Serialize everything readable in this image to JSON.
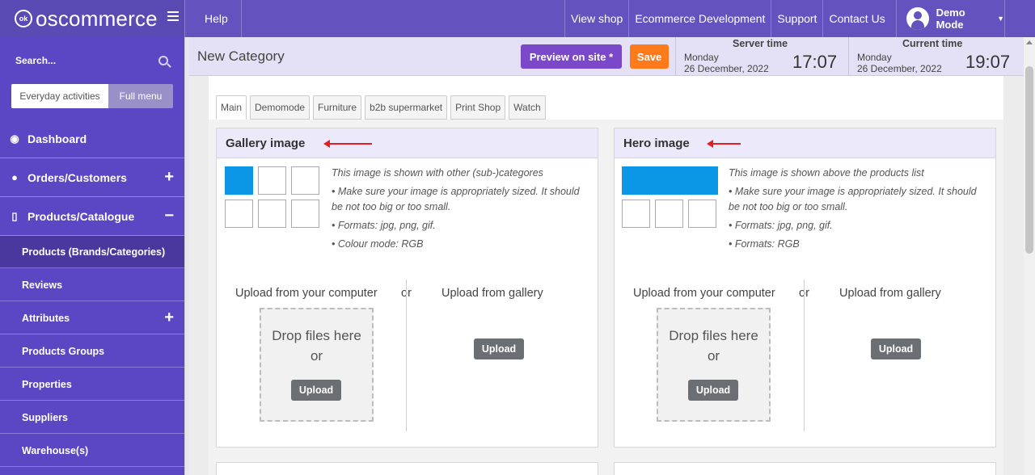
{
  "brand": {
    "logo_mark": "ok",
    "name": "oscommerce"
  },
  "sidebar": {
    "search_placeholder": "Search...",
    "modes": {
      "everyday": "Everyday activities",
      "full": "Full menu"
    },
    "main_items": [
      {
        "label": "Dashboard",
        "icon": "dashboard-icon"
      },
      {
        "label": "Orders/Customers",
        "icon": "users-icon",
        "expander": "+"
      },
      {
        "label": "Products/Catalogue",
        "icon": "folder-open-icon",
        "expander": "−"
      }
    ],
    "sub_items": [
      {
        "label": "Products (Brands/Categories)"
      },
      {
        "label": "Reviews"
      },
      {
        "label": "Attributes",
        "expander": "+"
      },
      {
        "label": "Products Groups"
      },
      {
        "label": "Properties"
      },
      {
        "label": "Suppliers"
      },
      {
        "label": "Warehouse(s)"
      }
    ]
  },
  "topbar": {
    "help": "Help",
    "links": [
      "View shop",
      "Ecommerce Development",
      "Support",
      "Contact Us"
    ],
    "user": "Demo Mode"
  },
  "header": {
    "title": "New Category",
    "preview_label": "Preview on site *",
    "save_label": "Save",
    "server_time": {
      "label": "Server time",
      "day": "Monday",
      "date": "26 December, 2022",
      "time": "17:07"
    },
    "current_time": {
      "label": "Current time",
      "day": "Monday",
      "date": "26 December, 2022",
      "time": "19:07"
    }
  },
  "tabs": [
    "Main",
    "Demomode",
    "Furniture",
    "b2b supermarket",
    "Print Shop",
    "Watch"
  ],
  "cards": [
    {
      "title": "Gallery image",
      "desc": [
        "This image is shown with other (sub-)categores",
        "• Make sure your image is appropriately sized. It should be not too big or too small.",
        "• Formats: jpg, png, gif.",
        "• Colour mode: RGB"
      ],
      "upload_computer": "Upload from your computer",
      "or": "or",
      "upload_gallery": "Upload from gallery",
      "drop_text": "Drop files here",
      "drop_or": "or",
      "upload_btn": "Upload",
      "gallery_btn": "Upload"
    },
    {
      "title": "Hero image",
      "desc": [
        "This image is shown above the products list",
        "• Make sure your image is appropriately sized. It should be not too big or too small.",
        "• Formats: jpg, png, gif.",
        "• Formats: RGB"
      ],
      "upload_computer": "Upload from your computer",
      "or": "or",
      "upload_gallery": "Upload from gallery",
      "drop_text": "Drop files here",
      "drop_or": "or",
      "upload_btn": "Upload",
      "gallery_btn": "Upload"
    }
  ],
  "colors": {
    "sidebar": "#5b47c4",
    "topbar": "#6453be",
    "preview": "#7a48c9",
    "save": "#ff7a1a",
    "selected": "#0b97e6",
    "arrow": "#e02020"
  }
}
